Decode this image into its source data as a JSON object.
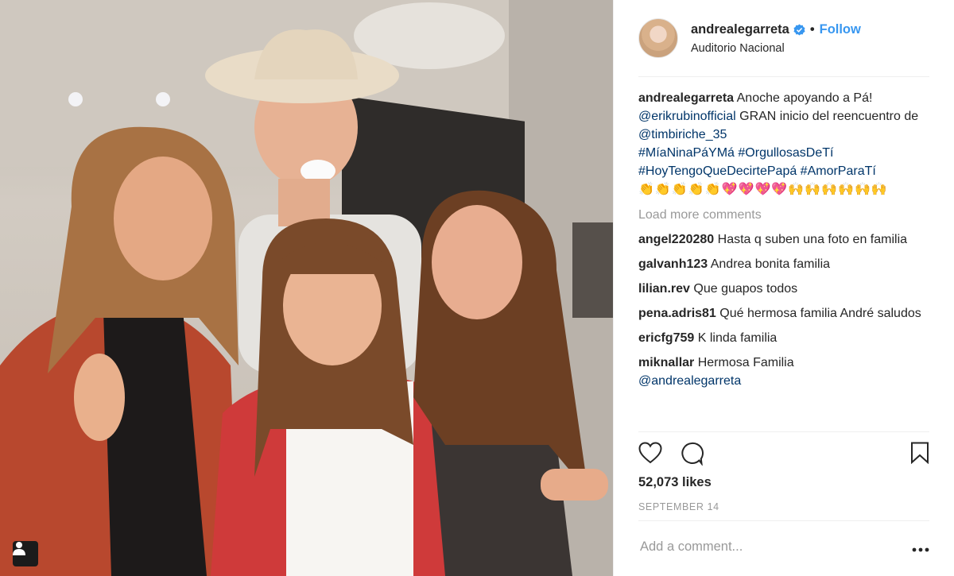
{
  "post": {
    "username": "andrealegarreta",
    "follow_label": "Follow",
    "separator": "•",
    "location": "Auditorio Nacional"
  },
  "caption": {
    "username": "andrealegarreta",
    "text_1": "Anoche apoyando a Pá!",
    "mention_1": "@erikrubinofficial",
    "text_2": "GRAN inicio del reencuentro de",
    "mention_2": "@timbiriche_35",
    "hashtags_line_1": "#MíaNinaPáYMá #OrgullosasDeTí",
    "hashtags_line_2": "#HoyTengoQueDecirtePapá #AmorParaTí",
    "emoji_clap": "👏👏👏👏👏",
    "emoji_hearts": "💖💖💖💖",
    "emoji_hands": "🙌🙌🙌🙌🙌🙌"
  },
  "load_more_label": "Load more comments",
  "comments": [
    {
      "user": "angel220280",
      "text": "Hasta q suben una foto en familia"
    },
    {
      "user": "galvanh123",
      "text": "Andrea bonita familia"
    },
    {
      "user": "lilian.rev",
      "text": "Que guapos todos"
    },
    {
      "user": "pena.adris81",
      "text": "Qué hermosa familia André saludos"
    },
    {
      "user": "ericfg759",
      "text": "K linda familia"
    },
    {
      "user": "miknallar",
      "text": "Hermosa Familia",
      "mention": "@andrealegarreta"
    }
  ],
  "likes_label": "52,073 likes",
  "date_label": "SEPTEMBER 14",
  "add_comment_placeholder": "Add a comment...",
  "icons": {
    "like": "heart-outline",
    "comment": "speech-bubble-outline",
    "save": "bookmark-outline",
    "more": "three-dots",
    "verified": "verified-badge",
    "user_tags": "person-silhouette"
  },
  "colors": {
    "accent": "#3897f0",
    "mention": "#003569",
    "muted": "#999999",
    "text": "#262626"
  }
}
